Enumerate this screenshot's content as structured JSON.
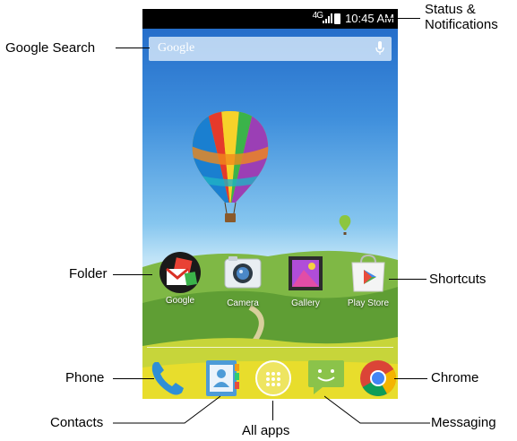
{
  "status_bar": {
    "network": "4G",
    "time": "10:45 AM"
  },
  "search": {
    "logo_text": "Google"
  },
  "home_apps": [
    {
      "label": "Google",
      "icon": "folder-icon"
    },
    {
      "label": "Camera",
      "icon": "camera-icon"
    },
    {
      "label": "Gallery",
      "icon": "gallery-icon"
    },
    {
      "label": "Play Store",
      "icon": "play-store-icon"
    }
  ],
  "dock": [
    {
      "icon": "phone-icon"
    },
    {
      "icon": "contacts-icon"
    },
    {
      "icon": "all-apps-icon"
    },
    {
      "icon": "messaging-icon"
    },
    {
      "icon": "chrome-icon"
    }
  ],
  "callouts": {
    "status_line1": "Status &",
    "status_line2": "Notifications",
    "google_search": "Google Search",
    "folder": "Folder",
    "shortcuts": "Shortcuts",
    "phone": "Phone",
    "chrome": "Chrome",
    "contacts": "Contacts",
    "all_apps": "All apps",
    "messaging": "Messaging"
  },
  "colors": {
    "sky_top": "#1f66c6",
    "grass": "#6cae3a",
    "chrome_red": "#db4437",
    "chrome_green": "#0f9d58",
    "chrome_yellow": "#f4b400",
    "chrome_blue": "#4285f4",
    "messaging_green": "#8bc34a"
  }
}
